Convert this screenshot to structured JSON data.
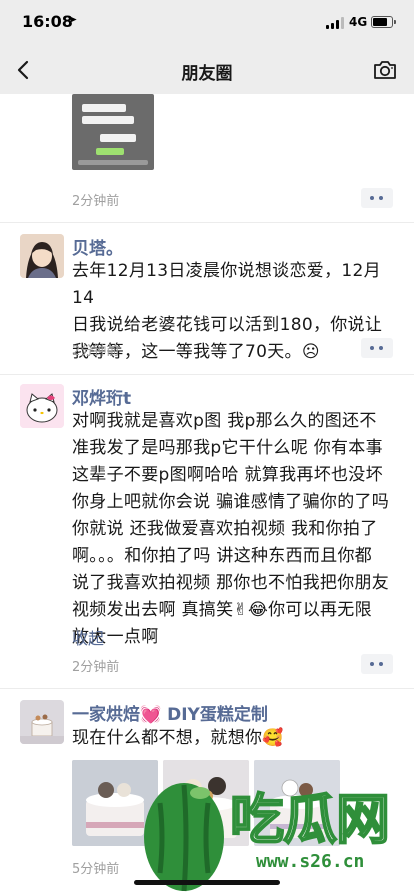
{
  "status_bar": {
    "time": "16:08",
    "location_icon": "location-arrow-icon",
    "network": "4G",
    "battery_percent": 80
  },
  "nav": {
    "title": "朋友圈",
    "back_icon": "chevron-left-icon",
    "camera_icon": "camera-icon"
  },
  "posts": [
    {
      "timestamp": "2分钟前"
    },
    {
      "author": "贝塔。",
      "lines": [
        "去年12月13日凌晨你说想谈恋爱，12月14",
        "日我说给老婆花钱可以活到180，你说让",
        "我等等，这一等我等了70天。☹"
      ],
      "timestamp": "2分钟前"
    },
    {
      "author": "邓烨珩t",
      "lines": [
        "对啊我就是喜欢p图 我p那么久的图还不",
        "准我发了是吗那我p它干什么呢 你有本事",
        "这辈子不要p图啊哈哈 就算我再坏也没坏",
        "你身上吧就你会说 骗谁感情了骗你的了吗",
        "你就说 还我做爱喜欢拍视频 我和你拍了",
        "啊。。。和你拍了吗 讲这种东西而且你都",
        "说了我喜欢拍视频 那你也不怕我把你朋友",
        "视频发出去啊 真搞笑✌😂你可以再无限",
        "放大一点啊"
      ],
      "collapse": "收起",
      "timestamp": "2分钟前"
    },
    {
      "author": "一家烘焙💓 DIY蛋糕定制",
      "lines": [
        "现在什么都不想，就想你🥰"
      ],
      "timestamp": "5分钟前"
    }
  ],
  "watermark": {
    "text": "吃瓜网",
    "url": "www.s26.cn"
  },
  "colors": {
    "link": "#576b95",
    "nav_bg": "#ededed",
    "timestamp": "#a0a0a0"
  }
}
